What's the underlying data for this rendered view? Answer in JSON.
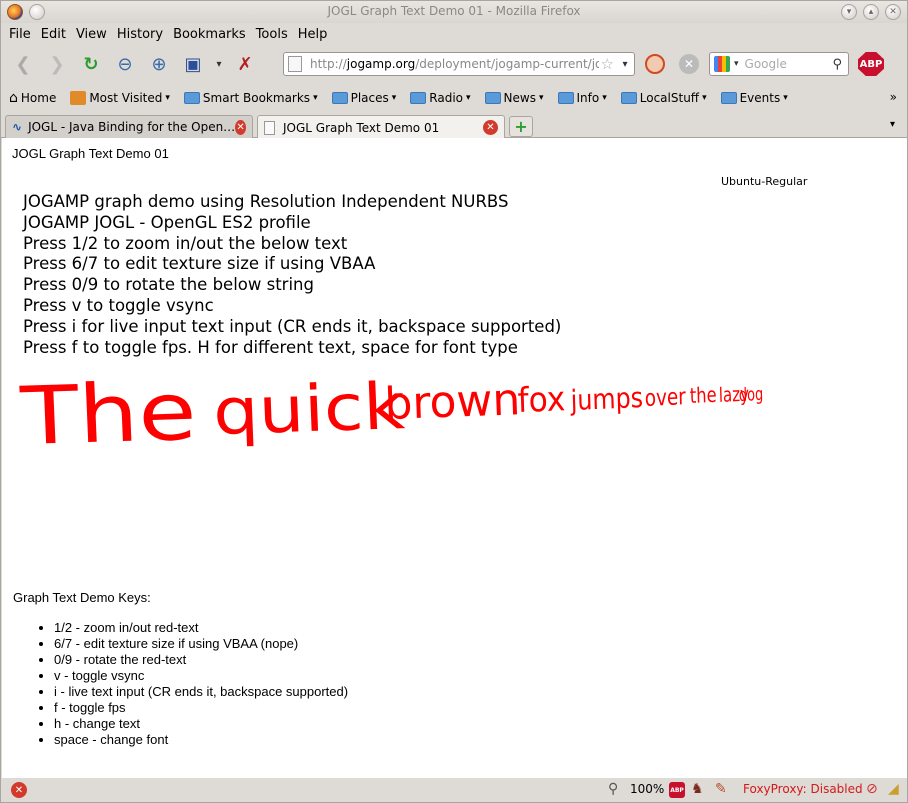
{
  "window": {
    "title": "JOGL Graph Text Demo 01 - Mozilla Firefox"
  },
  "menu": {
    "items": [
      "File",
      "Edit",
      "View",
      "History",
      "Bookmarks",
      "Tools",
      "Help"
    ]
  },
  "navbar": {
    "url_prefix": "http://",
    "url_host": "jogamp.org",
    "url_path": "/deployment/jogamp-current/jogl-ap",
    "search_placeholder": "Google",
    "abp_label": "ABP"
  },
  "bookmarks": {
    "items": [
      {
        "label": "Home",
        "icon": "home-icon",
        "menu": false
      },
      {
        "label": "Most Visited",
        "icon": "most-visited-icon",
        "menu": true
      },
      {
        "label": "Smart Bookmarks",
        "icon": "folder-icon",
        "menu": true
      },
      {
        "label": "Places",
        "icon": "folder-icon",
        "menu": true
      },
      {
        "label": "Radio",
        "icon": "folder-icon",
        "menu": true
      },
      {
        "label": "News",
        "icon": "folder-icon",
        "menu": true
      },
      {
        "label": "Info",
        "icon": "folder-icon",
        "menu": true
      },
      {
        "label": "LocalStuff",
        "icon": "folder-icon",
        "menu": true
      },
      {
        "label": "Events",
        "icon": "folder-icon",
        "menu": true
      }
    ],
    "overflow": "»"
  },
  "tabs": [
    {
      "label": "JOGL - Java Binding for the Open…",
      "active": false
    },
    {
      "label": "JOGL Graph Text Demo 01",
      "active": true
    }
  ],
  "content": {
    "heading": "JOGL Graph Text Demo 01",
    "font_name": "Ubuntu-Regular",
    "demo_lines": [
      "JOGAMP graph demo using Resolution Independent NURBS",
      "JOGAMP JOGL - OpenGL ES2 profile",
      "Press 1/2 to zoom in/out the below text",
      "Press 6/7 to edit texture size if using VBAA",
      "Press 0/9 to rotate the below string",
      "Press v to toggle vsync",
      "Press i for live input text input (CR ends it, backspace supported)",
      "Press f to toggle fps. H for different text, space for font type"
    ],
    "red_text": [
      "The",
      "quick",
      "brown",
      "fox",
      "jumps",
      "over",
      "the",
      "lazy",
      "dog"
    ],
    "red_color": "#ff0000",
    "keys_title": "Graph Text Demo Keys:",
    "keys": [
      "1/2 - zoom in/out red-text",
      "6/7 - edit texture size if using VBAA (nope)",
      "0/9 - rotate the red-text",
      "v - toggle vsync",
      "i - live text input (CR ends it, backspace supported)",
      "f - toggle fps",
      "h - change text",
      "space - change font"
    ]
  },
  "statusbar": {
    "zoom": "100%",
    "abp_label": "ABP",
    "foxyproxy": "FoxyProxy: Disabled"
  }
}
